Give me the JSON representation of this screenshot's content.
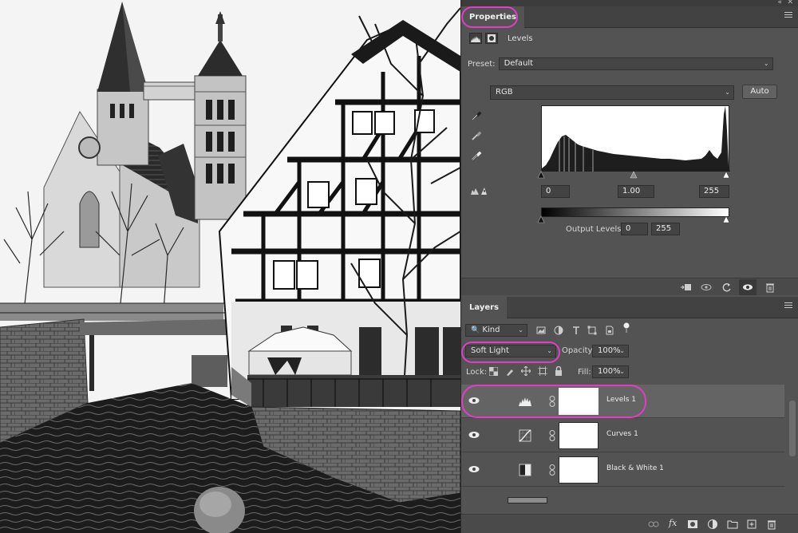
{
  "properties_panel": {
    "tab_label": "Properties",
    "adjustment_title": "Levels",
    "preset_label": "Preset:",
    "preset_value": "Default",
    "channel_value": "RGB",
    "auto_button": "Auto",
    "input_black": "0",
    "input_gamma": "1.00",
    "input_white": "255",
    "output_label": "Output Levels:",
    "output_black": "0",
    "output_white": "255",
    "footer_icons": [
      "clip-to-layer-icon",
      "view-previous-state-icon",
      "reset-icon",
      "toggle-visibility-icon",
      "delete-icon"
    ]
  },
  "layers_panel": {
    "tab_label": "Layers",
    "filter_kind": "Kind",
    "blend_mode": "Soft Light",
    "opacity_label": "Opacity:",
    "opacity_value": "100%",
    "lock_label": "Lock:",
    "fill_label": "Fill:",
    "fill_value": "100%",
    "layers": [
      {
        "name": "Levels 1",
        "icon": "levels-icon",
        "selected": true,
        "visible": true
      },
      {
        "name": "Curves 1",
        "icon": "curves-icon",
        "selected": false,
        "visible": true
      },
      {
        "name": "Black & White 1",
        "icon": "black-white-icon",
        "selected": false,
        "visible": true
      }
    ],
    "footer_icons": [
      "link-icon",
      "fx-icon",
      "add-mask-icon",
      "adjustment-icon",
      "folder-icon",
      "new-layer-icon",
      "delete-icon"
    ]
  },
  "accent_highlight_color": "#e23ec5",
  "panel_background": "#535353"
}
